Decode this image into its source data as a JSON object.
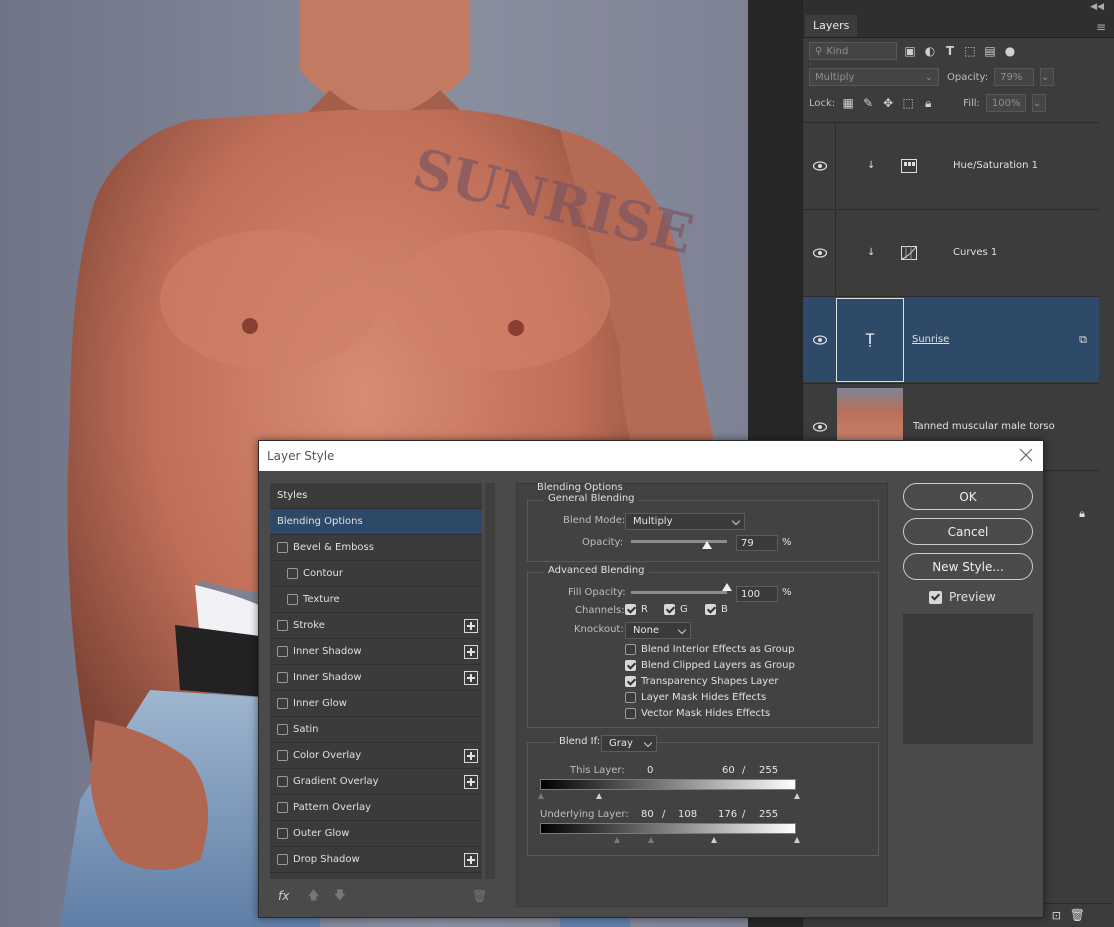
{
  "canvas": {
    "tattoo_text": "SUNRISE"
  },
  "layers_panel": {
    "tab": "Layers",
    "filter": {
      "kind_label": "Kind"
    },
    "blend_mode": "Multiply",
    "opacity_label": "Opacity:",
    "opacity_value": "79%",
    "lock_label": "Lock:",
    "fill_label": "Fill:",
    "fill_value": "100%",
    "layers": [
      {
        "name": "Hue/Saturation 1",
        "type": "adjustment",
        "clipped": true
      },
      {
        "name": "Curves 1",
        "type": "adjustment",
        "clipped": true
      },
      {
        "name": "Sunrise",
        "type": "text",
        "selected": true
      },
      {
        "name": "Tanned muscular male torso",
        "type": "image"
      }
    ]
  },
  "dialog": {
    "title": "Layer Style",
    "styles": [
      {
        "label": "Styles",
        "kind": "header"
      },
      {
        "label": "Blending Options",
        "kind": "active"
      },
      {
        "label": "Bevel & Emboss",
        "checked": false
      },
      {
        "label": "Contour",
        "checked": false,
        "indent": true
      },
      {
        "label": "Texture",
        "checked": false,
        "indent": true
      },
      {
        "label": "Stroke",
        "checked": false,
        "plus": true
      },
      {
        "label": "Inner Shadow",
        "checked": false,
        "plus": true
      },
      {
        "label": "Inner Shadow",
        "checked": false,
        "plus": true
      },
      {
        "label": "Inner Glow",
        "checked": false
      },
      {
        "label": "Satin",
        "checked": false
      },
      {
        "label": "Color Overlay",
        "checked": false,
        "plus": true
      },
      {
        "label": "Gradient Overlay",
        "checked": false,
        "plus": true
      },
      {
        "label": "Pattern Overlay",
        "checked": false
      },
      {
        "label": "Outer Glow",
        "checked": false
      },
      {
        "label": "Drop Shadow",
        "checked": false,
        "plus": true
      }
    ],
    "fx_label": "fx",
    "blending": {
      "section_title": "Blending Options",
      "general_title": "General Blending",
      "blend_mode_label": "Blend Mode:",
      "blend_mode": "Multiply",
      "opacity_label": "Opacity:",
      "opacity": "79",
      "opacity_fraction": 0.79,
      "percent": "%",
      "advanced_title": "Advanced Blending",
      "fill_label": "Fill Opacity:",
      "fill": "100",
      "fill_fraction": 1.0,
      "channels_label": "Channels:",
      "channels": [
        {
          "label": "R",
          "checked": true
        },
        {
          "label": "G",
          "checked": true
        },
        {
          "label": "B",
          "checked": true
        }
      ],
      "knockout_label": "Knockout:",
      "knockout": "None",
      "options": [
        {
          "label": "Blend Interior Effects as Group",
          "checked": false
        },
        {
          "label": "Blend Clipped Layers as Group",
          "checked": true
        },
        {
          "label": "Transparency Shapes Layer",
          "checked": true
        },
        {
          "label": "Layer Mask Hides Effects",
          "checked": false
        },
        {
          "label": "Vector Mask Hides Effects",
          "checked": false
        }
      ],
      "blend_if_label": "Blend If:",
      "blend_if": "Gray",
      "this_layer_label": "This Layer:",
      "this_layer": {
        "a": "0",
        "b": "60",
        "slash": "/",
        "c": "255"
      },
      "underlying_label": "Underlying Layer:",
      "underlying": {
        "a": "80",
        "slash1": "/",
        "b": "108",
        "c": "176",
        "slash2": "/",
        "d": "255"
      }
    },
    "buttons": {
      "ok": "OK",
      "cancel": "Cancel",
      "new_style": "New Style...",
      "preview": "Preview",
      "preview_checked": true
    }
  }
}
